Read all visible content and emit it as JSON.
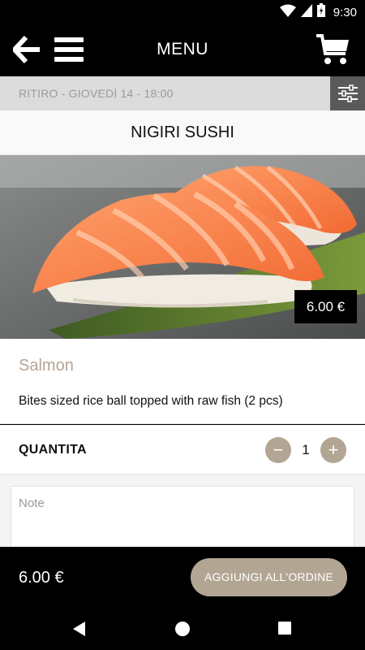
{
  "status_bar": {
    "time": "9:30"
  },
  "app_bar": {
    "title": "MENU"
  },
  "pickup": {
    "text": "RITIRO - GIOVEDÌ 14 - 18:00"
  },
  "category": {
    "title": "NIGIRI SUSHI"
  },
  "product": {
    "price": "6.00 €",
    "name": "Salmon",
    "description": "Bites sized rice ball topped with raw fish (2 pcs)"
  },
  "quantity": {
    "label": "QUANTITA",
    "value": "1",
    "minus": "−",
    "plus": "+"
  },
  "notes": {
    "placeholder": "Note"
  },
  "footer": {
    "total": "6.00 €",
    "add_button": "AGGIUNGI ALL'ORDINE"
  },
  "colors": {
    "accent": "#b3a593",
    "bar": "#000000",
    "pickup_bg": "#dcdcdc",
    "filter_bg": "#5a5a5a"
  },
  "icons": [
    "wifi-icon",
    "signal-icon",
    "battery-icon",
    "back-arrow-icon",
    "hamburger-menu-icon",
    "shopping-cart-icon",
    "filter-sliders-icon",
    "nav-back-icon",
    "nav-home-icon",
    "nav-recents-icon"
  ]
}
